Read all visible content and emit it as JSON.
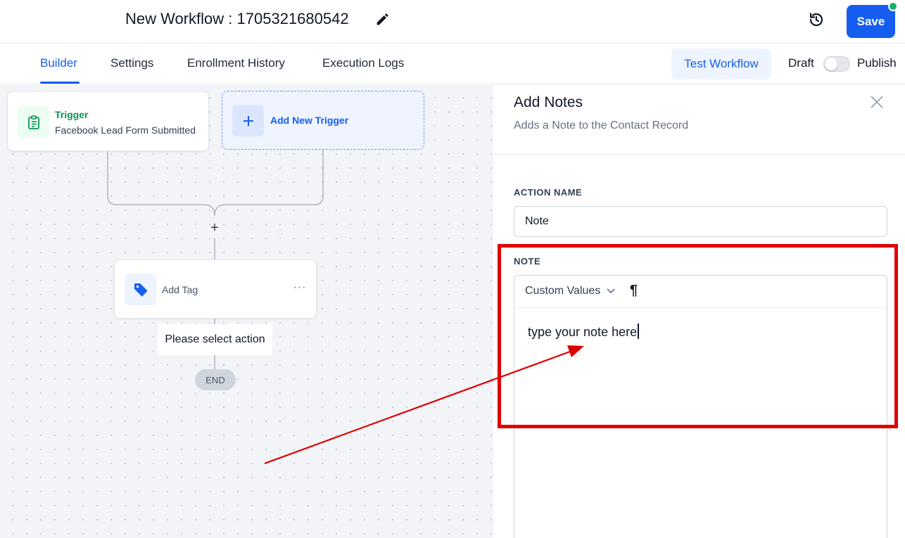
{
  "header": {
    "workflow_title": "New Workflow : 1705321680542",
    "save_label": "Save"
  },
  "tabs": [
    {
      "label": "Builder",
      "active": true
    },
    {
      "label": "Settings"
    },
    {
      "label": "Enrollment History"
    },
    {
      "label": "Execution Logs"
    }
  ],
  "toolbar": {
    "test_workflow_label": "Test Workflow",
    "draft_label": "Draft",
    "publish_label": "Publish",
    "publish_toggle_on": false
  },
  "canvas": {
    "trigger": {
      "title": "Trigger",
      "subtitle": "Facebook Lead Form Submitted",
      "icon": "clipboard-icon"
    },
    "add_trigger_label": "Add New Trigger",
    "add_step_symbol": "+",
    "action": {
      "label": "Add Tag",
      "icon": "tag-icon",
      "menu_symbol": "···"
    },
    "select_action_label": "Please select action",
    "end_label": "END"
  },
  "panel": {
    "title": "Add Notes",
    "subtitle": "Adds a Note to the Contact Record",
    "action_name_label": "ACTION NAME",
    "action_name_value": "Note",
    "note_label": "NOTE",
    "custom_values_label": "Custom Values",
    "paragraph_symbol": "¶",
    "note_text": "type your note here"
  },
  "colors": {
    "primary": "#155eef",
    "trigger_green": "#079455",
    "annotation_red": "#e00000",
    "status_dot": "#17b26a"
  }
}
